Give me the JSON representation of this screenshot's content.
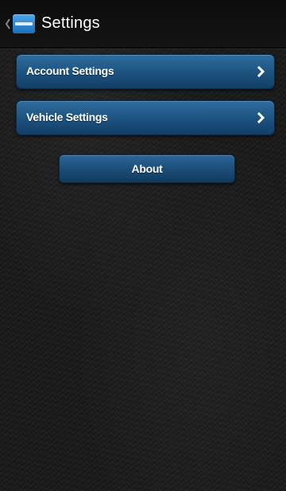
{
  "action_bar": {
    "title": "Settings",
    "up_icon": "chevron-left-icon",
    "app_icon": "app-logo-icon"
  },
  "menu": {
    "items": [
      {
        "label": "Account Settings",
        "icon": "chevron-right-icon"
      },
      {
        "label": "Vehicle Settings",
        "icon": "chevron-right-icon"
      }
    ]
  },
  "about": {
    "label": "About"
  },
  "colors": {
    "button_blue": "#1f5684",
    "background": "#1b1b1b",
    "text": "#ffffff"
  }
}
